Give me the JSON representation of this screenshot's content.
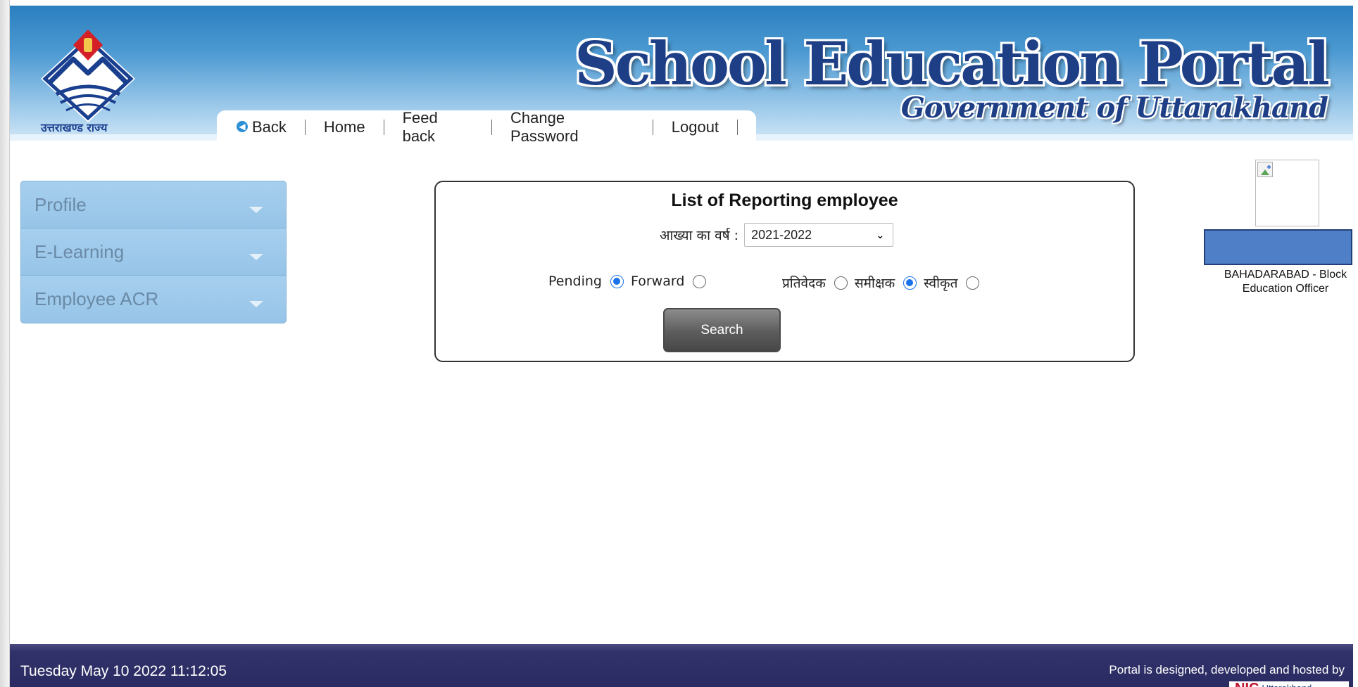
{
  "header": {
    "logo_caption": "उत्तराखण्ड राज्य",
    "title": "School Education Portal",
    "subtitle": "Government of Uttarakhand",
    "nav": {
      "back": "Back",
      "home": "Home",
      "feedback": "Feed back",
      "change_password": "Change Password",
      "logout": "Logout"
    }
  },
  "sidebar": {
    "items": [
      {
        "label": "Profile"
      },
      {
        "label": "E-Learning"
      },
      {
        "label": "Employee ACR"
      }
    ]
  },
  "panel": {
    "title": "List of Reporting employee",
    "year_label": "आख्या का वर्ष :",
    "year_value": "2021-2022",
    "status": {
      "pending_label": "Pending",
      "pending_checked": true,
      "forward_label": "Forward",
      "forward_checked": false
    },
    "role": {
      "reporter_label": "प्रतिवेदक",
      "reporter_checked": false,
      "reviewer_label": "समीक्षक",
      "reviewer_checked": true,
      "accepted_label": "स्वीकृत",
      "accepted_checked": false
    },
    "search_label": "Search"
  },
  "profile": {
    "designation": "BAHADARABAD - Block Education Officer"
  },
  "footer": {
    "datetime": "Tuesday May 10 2022 11:12:05",
    "credit": "Portal is designed, developed and hosted by",
    "nic": "NIC",
    "nic_sub": "Uttarakhand"
  },
  "colors": {
    "header_top": "#2a7fbf",
    "brand_blue": "#1e3f86",
    "sidebar_bg": "#9cc9ec",
    "footer_bg": "#2b2b63",
    "radio_accent": "#1a73e8"
  }
}
